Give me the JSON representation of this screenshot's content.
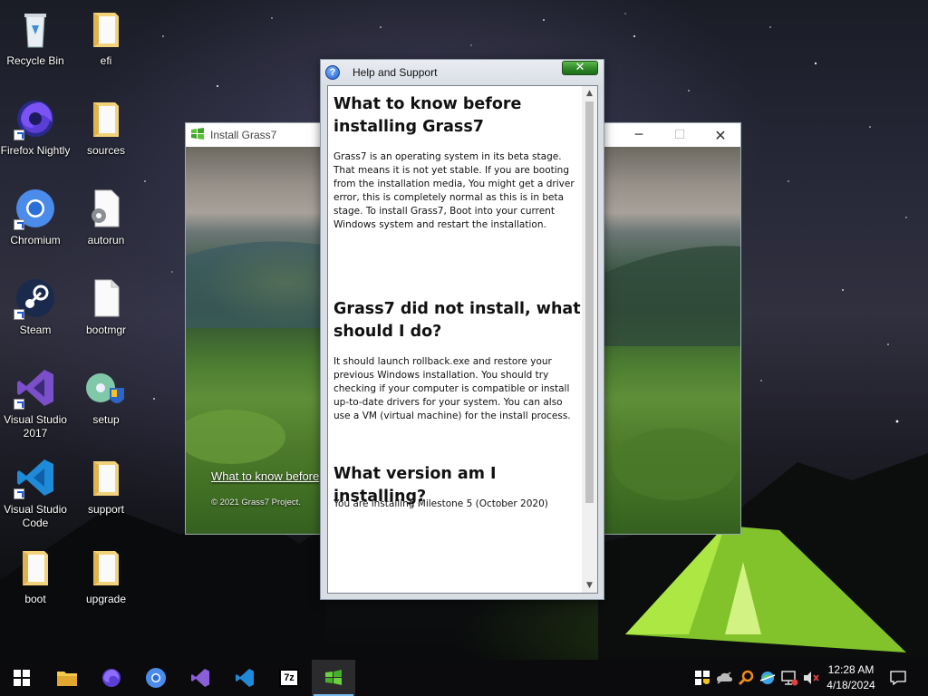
{
  "desktop": {
    "icons": [
      {
        "label": "Recycle Bin",
        "icon": "recycle-bin-icon"
      },
      {
        "label": "efi",
        "icon": "folder-icon"
      },
      {
        "label": "Firefox Nightly",
        "icon": "firefox-nightly-icon"
      },
      {
        "label": "sources",
        "icon": "folder-icon"
      },
      {
        "label": "Chromium",
        "icon": "chromium-icon"
      },
      {
        "label": "autorun",
        "icon": "settings-file-icon"
      },
      {
        "label": "Steam",
        "icon": "steam-icon"
      },
      {
        "label": "bootmgr",
        "icon": "file-icon"
      },
      {
        "label": "Visual Studio 2017",
        "icon": "visual-studio-icon"
      },
      {
        "label": "setup",
        "icon": "setup-icon"
      },
      {
        "label": "Visual Studio Code",
        "icon": "vscode-icon"
      },
      {
        "label": "support",
        "icon": "folder-icon"
      },
      {
        "label": "boot",
        "icon": "folder-icon"
      },
      {
        "label": "upgrade",
        "icon": "folder-icon"
      }
    ]
  },
  "installer": {
    "title": "Install Grass7",
    "link": "What to know before",
    "copyright": "© 2021 Grass7 Project."
  },
  "help": {
    "title": "Help and Support",
    "close": "✕",
    "sections": [
      {
        "heading": "What to know before installing Grass7",
        "body": "Grass7 is an operating system in its beta stage. That means it is not yet stable. If you are booting from the installation media, You might get a driver error, this is completely normal as this is in beta stage. To install Grass7, Boot into your current Windows system and restart the installation."
      },
      {
        "heading": "Grass7 did not install, what should I do?",
        "body": "It should launch rollback.exe and restore your previous Windows installation. You should try checking if your computer is compatible or install up-to-date drivers for your system. You can also use a VM (virtual machine) for the install process."
      },
      {
        "heading": "What version am I installing?",
        "body": "You are installing Milestone 5 (October 2020)"
      }
    ]
  },
  "taskbar": {
    "apps": [
      "start-icon",
      "file-explorer-icon",
      "firefox-icon",
      "chromium-icon",
      "visual-studio-icon",
      "vscode-icon",
      "7zip-icon",
      "grass7-installer-icon"
    ],
    "seven_zip_label": "7z",
    "time": "12:28 AM",
    "date": "4/18/2024"
  },
  "colors": {
    "accent": "#76b9ed",
    "help_close": "#2d8a27"
  }
}
